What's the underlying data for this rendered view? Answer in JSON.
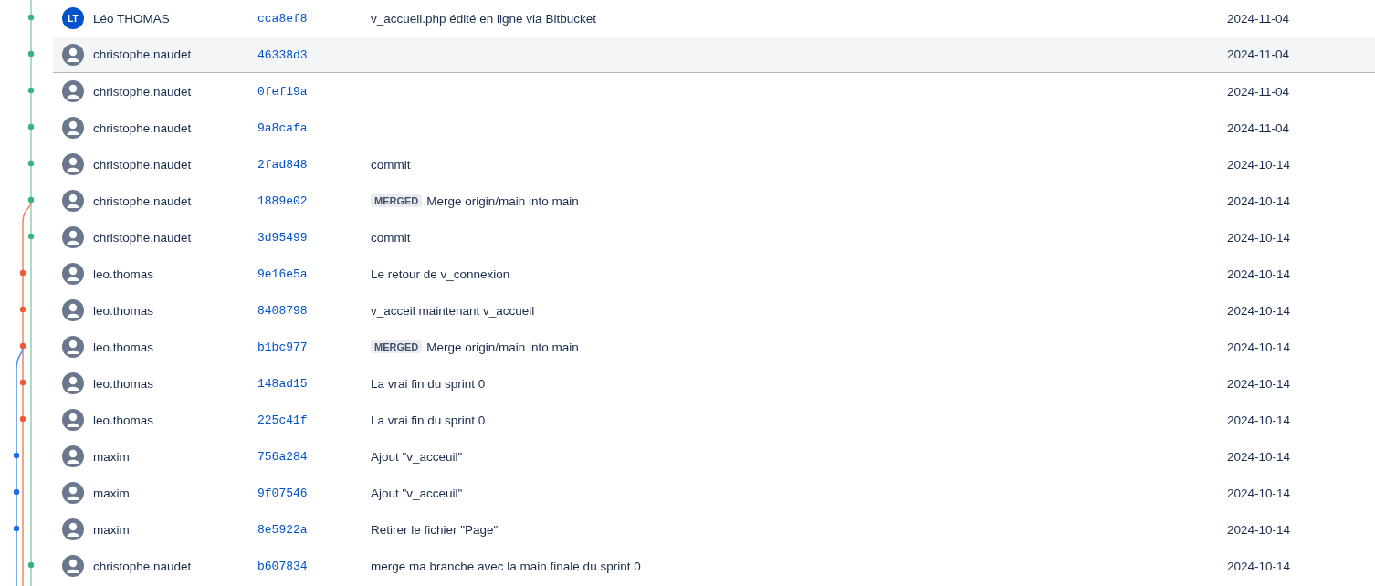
{
  "commits": [
    {
      "author": "Léo THOMAS",
      "initials": "LT",
      "hash": "cca8ef8",
      "message": "v_accueil.php édité en ligne via Bitbucket",
      "date": "2024-11-04",
      "kind": "main",
      "color": "#36b37e",
      "highlighted": false
    },
    {
      "author": "christophe.naudet",
      "hash": "46338d3",
      "date": "2024-11-04",
      "kind": "main",
      "color": "#36b37e",
      "highlighted": true
    },
    {
      "author": "christophe.naudet",
      "hash": "0fef19a",
      "date": "2024-11-04",
      "kind": "main",
      "color": "#36b37e",
      "highlighted": false
    },
    {
      "author": "christophe.naudet",
      "hash": "9a8cafa",
      "date": "2024-11-04",
      "kind": "main",
      "color": "#36b37e",
      "highlighted": false
    },
    {
      "author": "christophe.naudet",
      "hash": "2fad848",
      "message": "commit",
      "date": "2024-10-14",
      "kind": "main",
      "color": "#36b37e",
      "highlighted": false
    },
    {
      "author": "christophe.naudet",
      "hash": "1889e02",
      "badge": "MERGED",
      "message": "Merge origin/main into main",
      "date": "2024-10-14",
      "kind": "main",
      "color": "#36b37e",
      "highlighted": false
    },
    {
      "author": "christophe.naudet",
      "hash": "3d95499",
      "message": "commit",
      "date": "2024-10-14",
      "kind": "main",
      "color": "#36b37e",
      "highlighted": false
    },
    {
      "author": "leo.thomas",
      "hash": "9e16e5a",
      "message": "Le retour de v_connexion",
      "date": "2024-10-14",
      "kind": "feature",
      "color": "#f05a32",
      "highlighted": false
    },
    {
      "author": "leo.thomas",
      "hash": "8408798",
      "message": "v_acceil maintenant v_accueil",
      "date": "2024-10-14",
      "kind": "feature",
      "color": "#f05a32",
      "highlighted": false
    },
    {
      "author": "leo.thomas",
      "hash": "b1bc977",
      "badge": "MERGED",
      "message": "Merge origin/main into main",
      "date": "2024-10-14",
      "kind": "feature",
      "color": "#f05a32",
      "highlighted": false
    },
    {
      "author": "leo.thomas",
      "hash": "148ad15",
      "message": "La vrai fin du sprint 0",
      "date": "2024-10-14",
      "kind": "feature",
      "color": "#f05a32",
      "highlighted": false
    },
    {
      "author": "leo.thomas",
      "hash": "225c41f",
      "message": "La vrai fin du sprint 0",
      "date": "2024-10-14",
      "kind": "feature",
      "color": "#f05a32",
      "highlighted": false
    },
    {
      "author": "maxim",
      "hash": "756a284",
      "message": "Ajout \"v_acceuil\"",
      "date": "2024-10-14",
      "kind": "side",
      "color": "#1d6fe8",
      "highlighted": false
    },
    {
      "author": "maxim",
      "hash": "9f07546",
      "message": "Ajout \"v_acceuil\"",
      "date": "2024-10-14",
      "kind": "side",
      "color": "#1d6fe8",
      "highlighted": false
    },
    {
      "author": "maxim",
      "hash": "8e5922a",
      "message": "Retirer le fichier \"Page\"",
      "date": "2024-10-14",
      "kind": "side",
      "color": "#1d6fe8",
      "highlighted": false
    },
    {
      "author": "christophe.naudet",
      "hash": "b607834",
      "message": "merge ma branche avec la main finale du sprint 0",
      "date": "2024-10-14",
      "kind": "main",
      "color": "#36b37e",
      "highlighted": false
    }
  ]
}
